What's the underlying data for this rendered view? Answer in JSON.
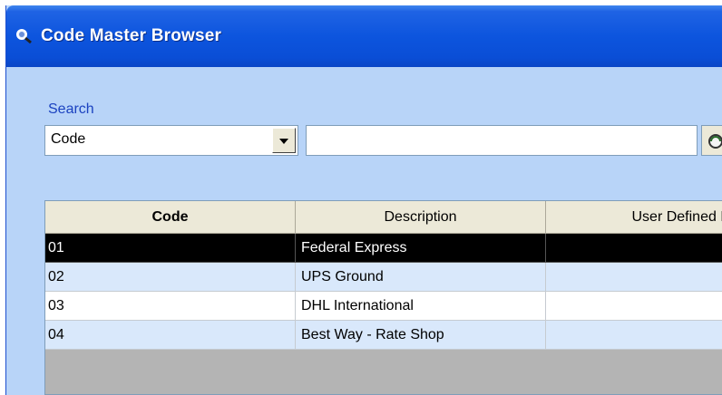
{
  "window": {
    "title": "Code Master Browser",
    "icon": "magnifier-icon"
  },
  "search": {
    "label": "Search",
    "field_selected": "Code",
    "query_value": "",
    "search_button_icon": "search-globe-icon"
  },
  "grid": {
    "columns": [
      "Code",
      "Description",
      "User Defined K"
    ],
    "rows": [
      {
        "code": "01",
        "description": "Federal Express",
        "user_defined": "",
        "selected": true
      },
      {
        "code": "02",
        "description": "UPS Ground",
        "user_defined": "",
        "selected": false
      },
      {
        "code": "03",
        "description": "DHL International",
        "user_defined": "",
        "selected": false
      },
      {
        "code": "04",
        "description": "Best Way - Rate Shop",
        "user_defined": "",
        "selected": false
      }
    ]
  },
  "colors": {
    "titlebar": "#0d55de",
    "body": "#b8d4f8",
    "selected_row": "#000000",
    "alt_row": "#d9e8fb",
    "label": "#1b42c0"
  }
}
